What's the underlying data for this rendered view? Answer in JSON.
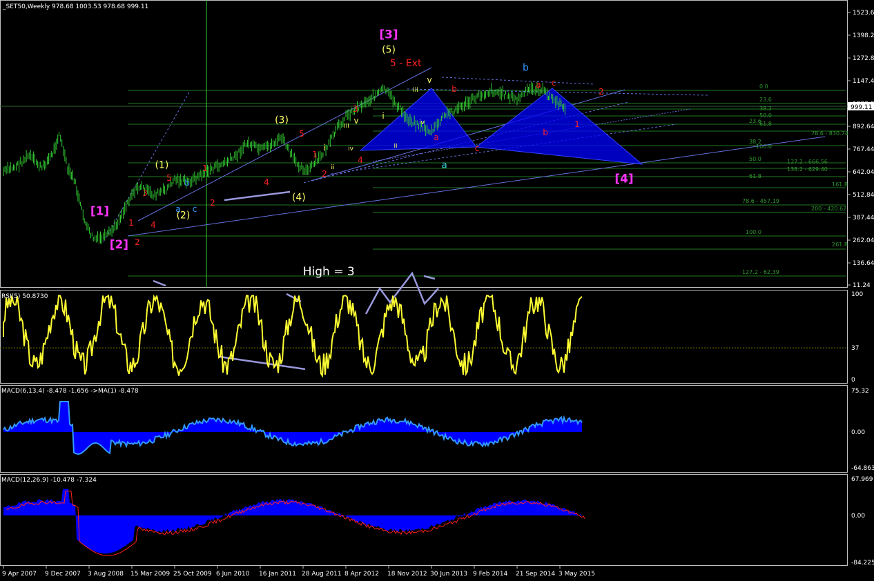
{
  "chart_data": [
    {
      "type": "line",
      "panel": "price",
      "header": "_SET50,Weekly  978.68 1003.53 978.68 999.11",
      "symbol": "_SET50",
      "timeframe": "Weekly",
      "ohlc": {
        "open": 978.68,
        "high": 1003.53,
        "low": 978.68,
        "close": 999.11
      },
      "last_price_label": "999.11",
      "y_ticks": [
        "1523.64",
        "1398.24",
        "1272.84",
        "1147.44",
        "1020.04",
        "892.64",
        "767.44",
        "642.04",
        "512.84",
        "387.44",
        "262.04",
        "136.64",
        "11.24"
      ],
      "y_range": [
        11.24,
        1523.64
      ],
      "x_ticks": [
        "9 Apr 2007",
        "9 Dec 2007",
        "3 Aug 2008",
        "15 Mar 2009",
        "25 Oct 2009",
        "6 Jun 2010",
        "16 Jan 2011",
        "28 Aug 2011",
        "8 Apr 2012",
        "18 Nov 2012",
        "30 Jun 2013",
        "9 Feb 2014",
        "21 Sep 2014",
        "3 May 2015"
      ],
      "series": [
        {
          "color": "#33cc33",
          "x": [
            0.0,
            0.3,
            0.6,
            0.9,
            1.15,
            1.3,
            1.4,
            1.5,
            1.65,
            1.8,
            1.95,
            2.1,
            2.2,
            2.4,
            2.6,
            2.8,
            3.0,
            3.2,
            3.5,
            3.8,
            4.0,
            4.3,
            4.6,
            4.9,
            5.1,
            5.4,
            5.7,
            6.0,
            6.2,
            6.5,
            6.8,
            7.1,
            7.4,
            7.6,
            7.8,
            8.0,
            8.3,
            8.6,
            8.9,
            9.1,
            9.4,
            9.7,
            10.0,
            10.3,
            10.6,
            10.9,
            11.1,
            11.4,
            11.7,
            12.0,
            12.3,
            12.6,
            12.9,
            13.0,
            13.15
          ],
          "y": [
            640,
            670,
            730,
            660,
            740,
            850,
            760,
            650,
            600,
            450,
            330,
            270,
            265,
            280,
            330,
            420,
            520,
            560,
            510,
            540,
            600,
            580,
            620,
            660,
            680,
            720,
            800,
            760,
            780,
            830,
            700,
            640,
            720,
            790,
            880,
            950,
            1000,
            1050,
            1100,
            1040,
            940,
            900,
            860,
            950,
            990,
            1030,
            1060,
            1090,
            1070,
            1040,
            1100,
            1090,
            1030,
            1010,
            999
          ]
        }
      ],
      "annotations": [
        {
          "text": "[3]",
          "color": "#ff33ff",
          "x": 9.0,
          "y": 1380
        },
        {
          "text": "(5)",
          "color": "#ffff66",
          "x": 9.0,
          "y": 1300
        },
        {
          "text": "5 - Ext",
          "color": "#ff2222",
          "x": 9.4,
          "y": 1225
        },
        {
          "text": "b",
          "color": "#3399ff",
          "x": 12.2,
          "y": 1200
        },
        {
          "text": "a",
          "color": "#33cccc",
          "x": 10.3,
          "y": 660
        },
        {
          "text": "[4]",
          "color": "#ff33ff",
          "x": 14.5,
          "y": 580
        },
        {
          "text": "[1]",
          "color": "#ff33ff",
          "x": 2.25,
          "y": 400
        },
        {
          "text": "[2]",
          "color": "#ff33ff",
          "x": 2.7,
          "y": 215
        },
        {
          "text": "(1)",
          "color": "#ffff66",
          "x": 3.7,
          "y": 660
        },
        {
          "text": "(2)",
          "color": "#ffff66",
          "x": 4.2,
          "y": 380
        },
        {
          "text": "(3)",
          "color": "#ffff66",
          "x": 6.5,
          "y": 910
        },
        {
          "text": "(4)",
          "color": "#ffff66",
          "x": 6.9,
          "y": 480
        },
        {
          "text": "High = 3",
          "color": "#ffffff",
          "x": 7.6,
          "y": 65
        }
      ],
      "fib_levels": [
        "0.0",
        "23.6",
        "38.2",
        "50.0",
        "61.8",
        "100.0",
        "127.2 - 666.56",
        "138.2 - 629.40",
        "161.8",
        "78.6 - 830.74",
        "78.6 - 457.19",
        "200 - 420.62",
        "261.8",
        "127.2 - 62.39"
      ]
    },
    {
      "type": "line",
      "panel": "rsi",
      "label": "RSI(5) 50.8730",
      "y_ticks": [
        "100",
        "37",
        "0"
      ],
      "level": 37,
      "series": [
        {
          "color": "#ffff33",
          "name": "RSI(5)",
          "x": [
            0,
            13.15
          ],
          "y": [
            50,
            50.873
          ]
        }
      ]
    },
    {
      "type": "area",
      "panel": "macd_fast",
      "label": "MACD(6,13,4) -8.478 -1.656  ->MA(1) -8.478",
      "y_ticks": [
        "75.32",
        "0.00",
        "-64.863"
      ],
      "series": [
        {
          "color": "#0000ff",
          "name": "MACD",
          "x": [
            0,
            13.15
          ],
          "y": [
            0,
            -8.478
          ]
        }
      ]
    },
    {
      "type": "area",
      "panel": "macd_slow",
      "label": "MACD(12,26,9) -10.478 -7.324",
      "y_ticks": [
        "67.969",
        "0.00",
        "-84.225"
      ],
      "series": [
        {
          "color": "#0000ff",
          "name": "MACD",
          "x": [
            0,
            13.15
          ],
          "y": [
            0,
            -10.478
          ]
        },
        {
          "color": "#ff2222",
          "name": "Signal",
          "x": [
            0,
            13.15
          ],
          "y": [
            0,
            -7.324
          ]
        }
      ]
    }
  ]
}
